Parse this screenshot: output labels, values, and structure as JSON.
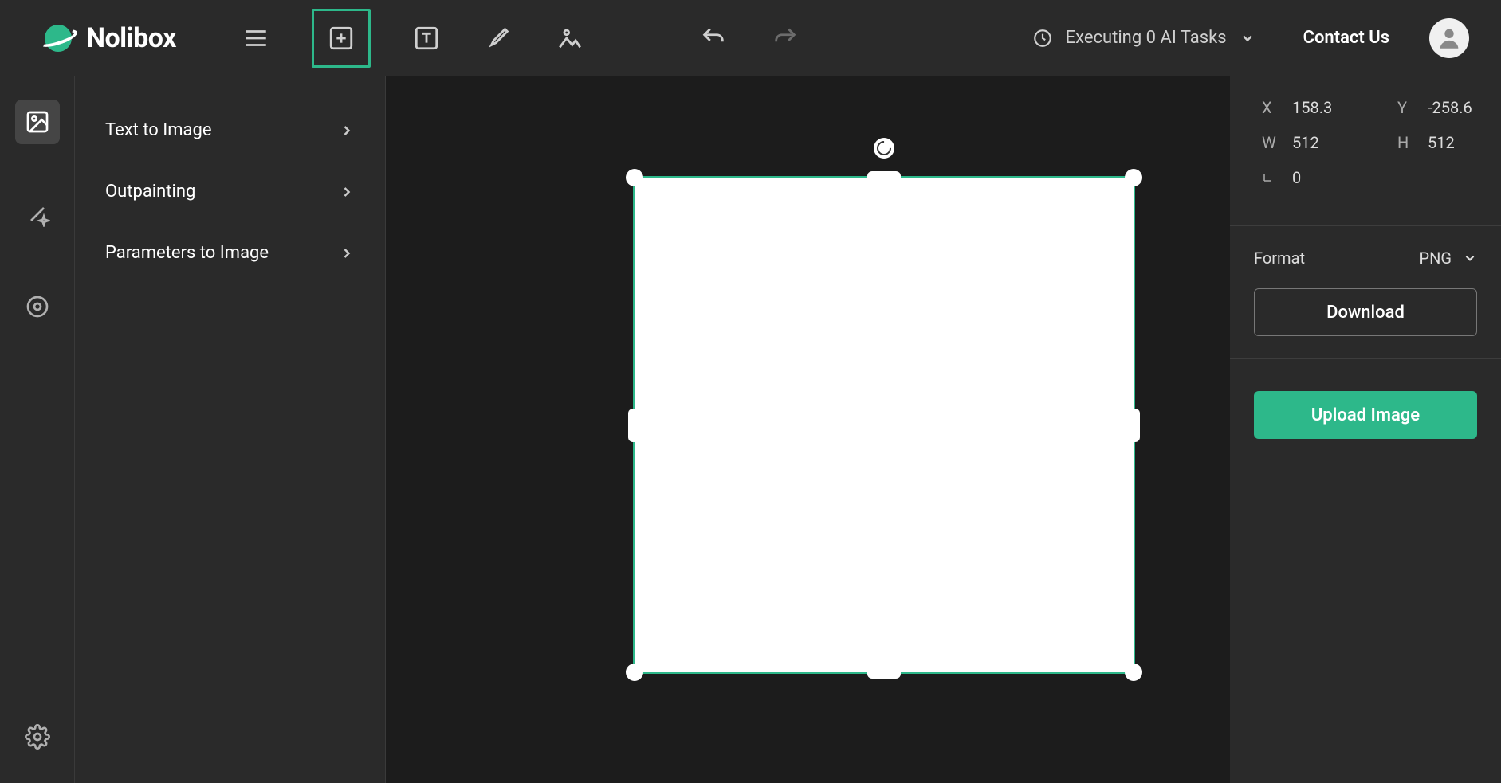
{
  "app": {
    "name": "Nolibox"
  },
  "header": {
    "status_label": "Executing 0 AI Tasks",
    "contact_label": "Contact Us"
  },
  "sidebar": {
    "items": [
      {
        "label": "Text to Image"
      },
      {
        "label": "Outpainting"
      },
      {
        "label": "Parameters to Image"
      }
    ]
  },
  "properties": {
    "x_label": "X",
    "x_value": "158.3",
    "y_label": "Y",
    "y_value": "-258.6",
    "w_label": "W",
    "w_value": "512",
    "h_label": "H",
    "h_value": "512",
    "r_label": "⌐",
    "r_value": "0"
  },
  "right": {
    "format_label": "Format",
    "format_value": "PNG",
    "download_label": "Download",
    "upload_label": "Upload Image"
  }
}
